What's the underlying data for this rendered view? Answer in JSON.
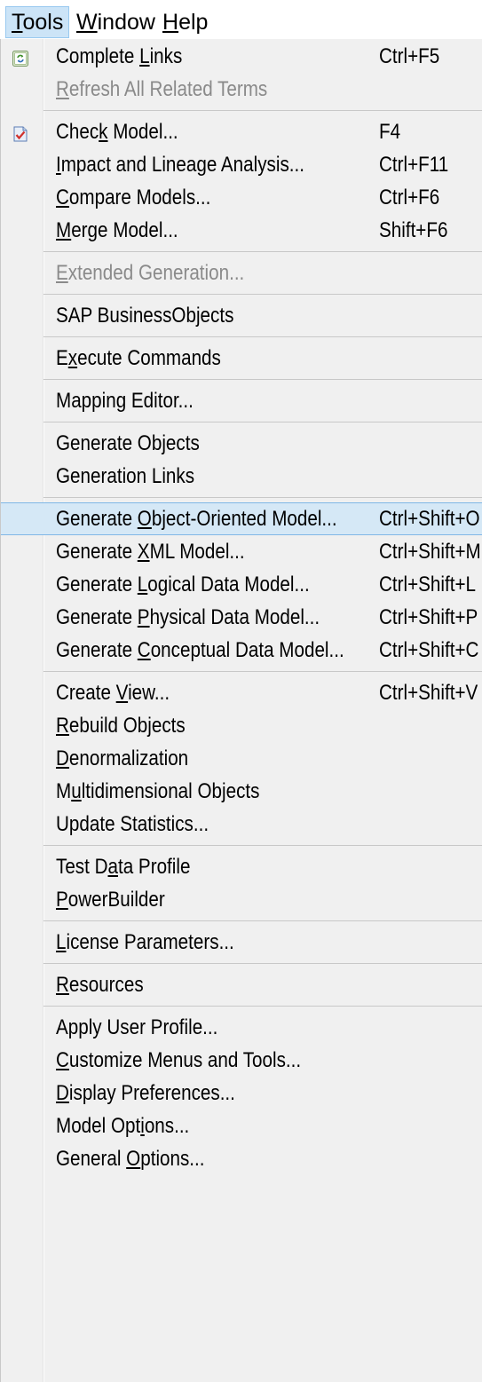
{
  "menubar": {
    "tools": {
      "pre": "",
      "mn": "T",
      "post": "ools"
    },
    "window": {
      "pre": "",
      "mn": "W",
      "post": "indow"
    },
    "help": {
      "pre": "",
      "mn": "H",
      "post": "elp"
    }
  },
  "colors": {
    "highlight_bg": "#d5e8f6",
    "highlight_border": "#7fb7e6",
    "disabled_text": "#8a8a8a",
    "menu_bg": "#f0f0f0"
  },
  "icons": {
    "complete_links": "refresh-links-icon",
    "check_model": "check-model-icon"
  },
  "menu": {
    "complete_links": {
      "pre": "Complete ",
      "mn": "L",
      "post": "inks",
      "shortcut": "Ctrl+F5"
    },
    "refresh_related": {
      "pre": "",
      "mn": "R",
      "post": "efresh All Related Terms"
    },
    "check_model": {
      "pre": "Chec",
      "mn": "k",
      "post": " Model...",
      "shortcut": "F4"
    },
    "impact_lineage": {
      "pre": "",
      "mn": "I",
      "post": "mpact and Lineage Analysis...",
      "shortcut": "Ctrl+F11"
    },
    "compare_models": {
      "pre": "",
      "mn": "C",
      "post": "ompare Models...",
      "shortcut": "Ctrl+F6"
    },
    "merge_model": {
      "pre": "",
      "mn": "M",
      "post": "erge Model...",
      "shortcut": "Shift+F6"
    },
    "extended_generation": {
      "pre": "",
      "mn": "E",
      "post": "xtended Generation..."
    },
    "sap_businessobjects": {
      "label": "SAP BusinessObjects"
    },
    "execute_commands": {
      "pre": "E",
      "mn": "x",
      "post": "ecute Commands"
    },
    "mapping_editor": {
      "label": "Mapping Editor..."
    },
    "generate_objects": {
      "label": "Generate Objects"
    },
    "generation_links": {
      "label": "Generation Links"
    },
    "gen_oom": {
      "pre": "Generate ",
      "mn": "O",
      "post": "bject-Oriented Model...",
      "shortcut": "Ctrl+Shift+O"
    },
    "gen_xml": {
      "pre": "Generate ",
      "mn": "X",
      "post": "ML Model...",
      "shortcut": "Ctrl+Shift+M"
    },
    "gen_ldm": {
      "pre": "Generate ",
      "mn": "L",
      "post": "ogical Data Model...",
      "shortcut": "Ctrl+Shift+L"
    },
    "gen_pdm": {
      "pre": "Generate ",
      "mn": "P",
      "post": "hysical Data Model...",
      "shortcut": "Ctrl+Shift+P"
    },
    "gen_cdm": {
      "pre": "Generate ",
      "mn": "C",
      "post": "onceptual Data Model...",
      "shortcut": "Ctrl+Shift+C"
    },
    "create_view": {
      "pre": "Create ",
      "mn": "V",
      "post": "iew...",
      "shortcut": "Ctrl+Shift+V"
    },
    "rebuild_objects": {
      "pre": "",
      "mn": "R",
      "post": "ebuild Objects"
    },
    "denormalization": {
      "pre": "",
      "mn": "D",
      "post": "enormalization"
    },
    "multidimensional": {
      "pre": "M",
      "mn": "u",
      "post": "ltidimensional Objects"
    },
    "update_statistics": {
      "label": "Update Statistics..."
    },
    "test_data_profile": {
      "pre": "Test D",
      "mn": "a",
      "post": "ta Profile"
    },
    "powerbuilder": {
      "pre": "",
      "mn": "P",
      "post": "owerBuilder"
    },
    "license_parameters": {
      "pre": "",
      "mn": "L",
      "post": "icense Parameters..."
    },
    "resources": {
      "pre": "",
      "mn": "R",
      "post": "esources"
    },
    "apply_user_profile": {
      "label": "Apply User Profile..."
    },
    "customize_menus": {
      "pre": "",
      "mn": "C",
      "post": "ustomize Menus and Tools..."
    },
    "display_preferences": {
      "pre": "",
      "mn": "D",
      "post": "isplay Preferences..."
    },
    "model_options": {
      "pre": "Model Opt",
      "mn": "i",
      "post": "ons..."
    },
    "general_options": {
      "pre": "General ",
      "mn": "O",
      "post": "ptions..."
    }
  }
}
